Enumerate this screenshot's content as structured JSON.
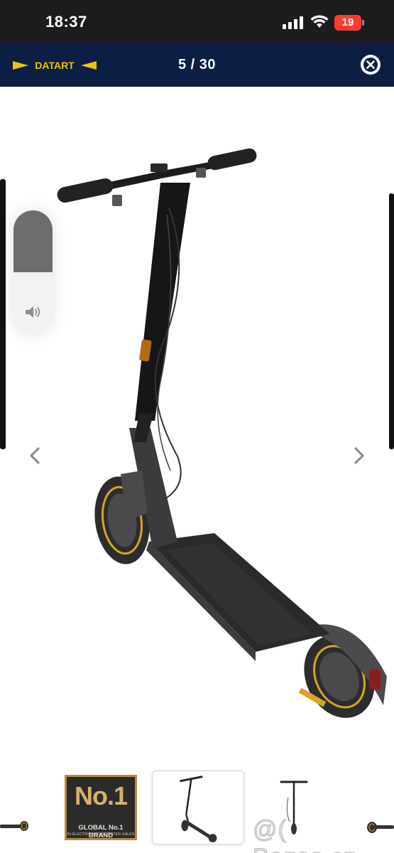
{
  "status_bar": {
    "time": "18:37",
    "battery_level": "19",
    "battery_color": "#ff3b30",
    "icons": [
      "signal-bars-icon",
      "wifi-icon",
      "battery-icon"
    ]
  },
  "viewer": {
    "brand": "DATART",
    "counter": "5 / 30",
    "header_color": "#0c1e44",
    "close_icon": "close-circle-icon",
    "prev_icon": "chevron-left-icon",
    "next_icon": "chevron-right-icon"
  },
  "volume_hud": {
    "level": 0.5,
    "icon": "speaker-icon"
  },
  "thumbnails": {
    "badge": {
      "headline": "No.1",
      "line1": "GLOBAL No.1 BRAND",
      "line2": "IN ELECTRIC KICKSCOOTER SALES"
    }
  },
  "watermark": "@( Bazos.cz"
}
